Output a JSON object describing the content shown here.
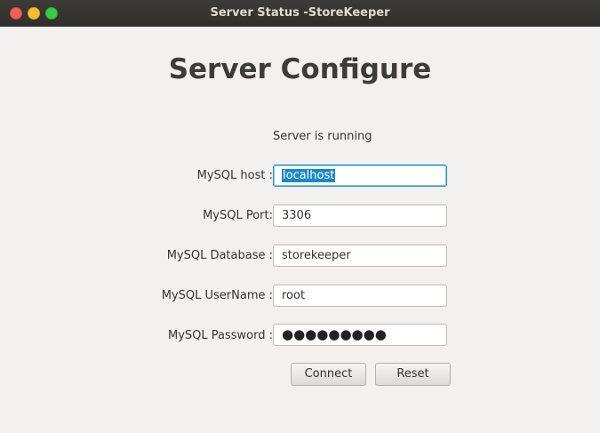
{
  "window": {
    "title": "Server Status -StoreKeeper"
  },
  "page": {
    "heading": "Server Configure",
    "status": "Server is running"
  },
  "form": {
    "host_label": "MySQL host :",
    "host_value": "localhost",
    "port_label": "MySQL Port:",
    "port_value": "3306",
    "database_label": "MySQL Database :",
    "database_value": "storekeeper",
    "username_label": "MySQL UserName :",
    "username_value": "root",
    "password_label": "MySQL Password :",
    "password_mask": "●●●●●●●●●"
  },
  "buttons": {
    "connect": "Connect",
    "reset": "Reset"
  },
  "colors": {
    "focus_border": "#1e8fc7",
    "selection": "#1a89c8",
    "titlebar": "#3c3b37"
  }
}
